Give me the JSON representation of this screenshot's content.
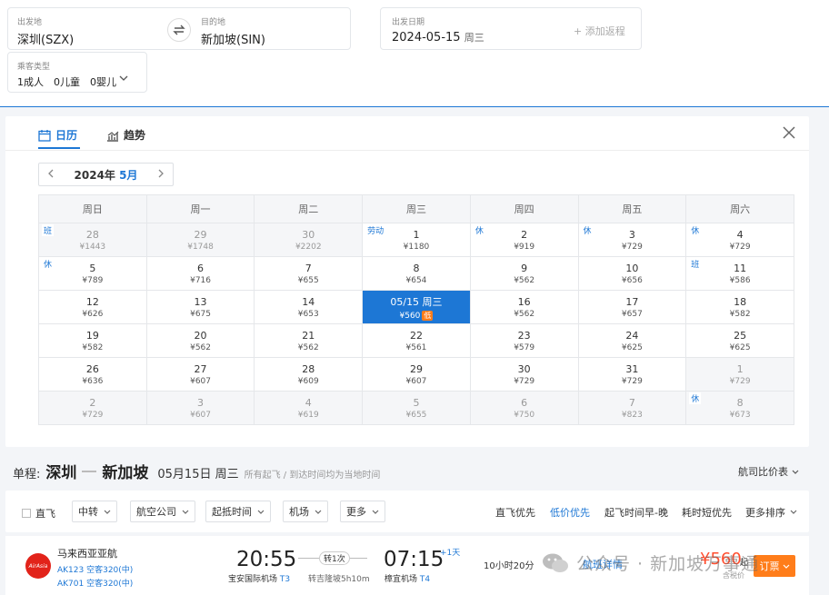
{
  "search": {
    "from_label": "出发地",
    "from_value": "深圳(SZX)",
    "to_label": "目的地",
    "to_value": "新加坡(SIN)",
    "date_label": "出发日期",
    "date_value": "2024-05-15",
    "date_weekday": "周三",
    "add_return": "+ 添加返程",
    "pax_label": "乘客类型",
    "pax_value": "1成人　0儿童　0婴儿"
  },
  "calendar": {
    "tab_calendar": "日历",
    "tab_trend": "趋势",
    "year": "2024年",
    "month": "5月",
    "weekdays": [
      "周日",
      "周一",
      "周二",
      "周三",
      "周四",
      "周五",
      "周六"
    ],
    "weeks": [
      [
        {
          "d": "28",
          "p": "¥1443",
          "off": true,
          "tag": "班"
        },
        {
          "d": "29",
          "p": "¥1748",
          "off": true
        },
        {
          "d": "30",
          "p": "¥2202",
          "off": true
        },
        {
          "d": "1",
          "p": "¥1180",
          "tag": "劳动"
        },
        {
          "d": "2",
          "p": "¥919",
          "tag": "休"
        },
        {
          "d": "3",
          "p": "¥729",
          "tag": "休"
        },
        {
          "d": "4",
          "p": "¥729",
          "tag": "休"
        }
      ],
      [
        {
          "d": "5",
          "p": "¥789",
          "tag": "休"
        },
        {
          "d": "6",
          "p": "¥716"
        },
        {
          "d": "7",
          "p": "¥655"
        },
        {
          "d": "8",
          "p": "¥654"
        },
        {
          "d": "9",
          "p": "¥562"
        },
        {
          "d": "10",
          "p": "¥656"
        },
        {
          "d": "11",
          "p": "¥586",
          "tag": "班"
        }
      ],
      [
        {
          "d": "12",
          "p": "¥626"
        },
        {
          "d": "13",
          "p": "¥675"
        },
        {
          "d": "14",
          "p": "¥653"
        },
        {
          "d": "05/15 周三",
          "p": "¥560",
          "sel": true,
          "low": "低"
        },
        {
          "d": "16",
          "p": "¥562"
        },
        {
          "d": "17",
          "p": "¥657"
        },
        {
          "d": "18",
          "p": "¥582"
        }
      ],
      [
        {
          "d": "19",
          "p": "¥582"
        },
        {
          "d": "20",
          "p": "¥562"
        },
        {
          "d": "21",
          "p": "¥562"
        },
        {
          "d": "22",
          "p": "¥561"
        },
        {
          "d": "23",
          "p": "¥579"
        },
        {
          "d": "24",
          "p": "¥625"
        },
        {
          "d": "25",
          "p": "¥625"
        }
      ],
      [
        {
          "d": "26",
          "p": "¥636"
        },
        {
          "d": "27",
          "p": "¥607"
        },
        {
          "d": "28",
          "p": "¥609"
        },
        {
          "d": "29",
          "p": "¥607"
        },
        {
          "d": "30",
          "p": "¥729"
        },
        {
          "d": "31",
          "p": "¥729"
        },
        {
          "d": "1",
          "p": "¥729",
          "off": true
        }
      ],
      [
        {
          "d": "2",
          "p": "¥729",
          "off": true
        },
        {
          "d": "3",
          "p": "¥607",
          "off": true
        },
        {
          "d": "4",
          "p": "¥619",
          "off": true
        },
        {
          "d": "5",
          "p": "¥655",
          "off": true
        },
        {
          "d": "6",
          "p": "¥750",
          "off": true
        },
        {
          "d": "7",
          "p": "¥823",
          "off": true
        },
        {
          "d": "8",
          "p": "¥673",
          "off": true,
          "tag": "休"
        }
      ]
    ]
  },
  "summary": {
    "prefix": "单程:",
    "from": "深圳",
    "to": "新加坡",
    "date": "05月15日 周三",
    "note": "所有起飞 / 到达时间均为当地时间",
    "compare": "航司比价表"
  },
  "filters": {
    "direct": "直飞",
    "transfer": "中转",
    "airline": "航空公司",
    "time": "起抵时间",
    "airport": "机场",
    "more": "更多",
    "sorts": [
      "直飞优先",
      "低价优先",
      "起飞时间早-晚",
      "耗时短优先",
      "更多排序"
    ]
  },
  "flight": {
    "airline": "马来西亚亚航",
    "logo_text": "AirAsia",
    "seg1": "AK123 空客320(中)",
    "seg2": "AK701 空客320(中)",
    "dep_time": "20:55",
    "dep_airport": "宝安国际机场",
    "dep_terminal": "T3",
    "stops": "转1次",
    "transfer": "转吉隆坡5h10m",
    "arr_time": "07:15",
    "arr_next": "+1天",
    "arr_airport": "樟宜机场",
    "arr_terminal": "T4",
    "duration": "10小时20分",
    "detail": "航班详情",
    "price": "¥560",
    "price_suffix": "起",
    "tax": "含税价",
    "book": "订票"
  },
  "watermark": "公众号 · 新加坡万事通",
  "colors": {
    "accent": "#1d77d5",
    "price": "#ff4d2e",
    "book": "#ff7d1a"
  }
}
